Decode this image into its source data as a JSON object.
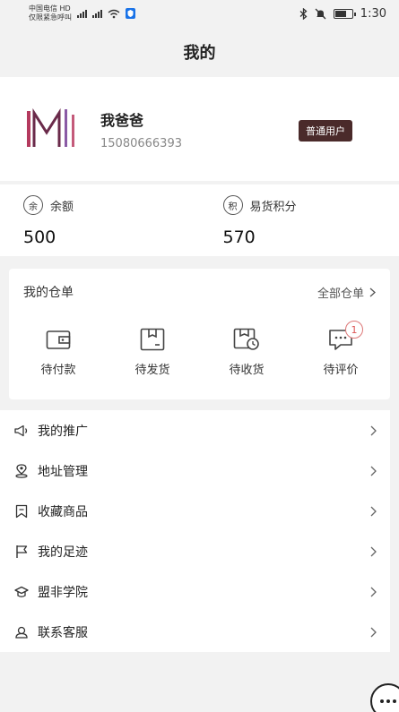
{
  "status": {
    "carrier_line1": "中国电信 HD",
    "carrier_line2": "仅限紧急呼叫",
    "time": "1:30"
  },
  "header": {
    "title": "我的"
  },
  "profile": {
    "name": "我爸爸",
    "phone": "15080666393",
    "badge": "普通用户",
    "logo_color": "#8e2d52"
  },
  "assets": [
    {
      "icon_char": "余",
      "label": "余额",
      "value": "500"
    },
    {
      "icon_char": "积",
      "label": "易货积分",
      "value": "570"
    }
  ],
  "orders": {
    "title": "我的仓单",
    "all_label": "全部仓单",
    "items": [
      {
        "icon": "wallet-icon",
        "label": "待付款"
      },
      {
        "icon": "box-icon",
        "label": "待发货"
      },
      {
        "icon": "receive-icon",
        "label": "待收货"
      },
      {
        "icon": "comment-icon",
        "label": "待评价",
        "badge": "1"
      }
    ]
  },
  "menu": [
    {
      "icon": "megaphone-icon",
      "label": "我的推广"
    },
    {
      "icon": "location-icon",
      "label": "地址管理"
    },
    {
      "icon": "bookmark-icon",
      "label": "收藏商品"
    },
    {
      "icon": "flag-icon",
      "label": "我的足迹"
    },
    {
      "icon": "graduation-icon",
      "label": "盟非学院"
    },
    {
      "icon": "service-icon",
      "label": "联系客服"
    }
  ]
}
